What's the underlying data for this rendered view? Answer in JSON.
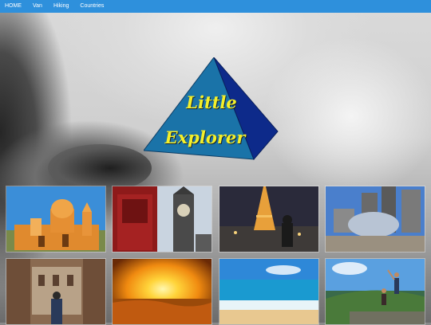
{
  "nav": {
    "items": [
      {
        "label": "HOME"
      },
      {
        "label": "Van"
      },
      {
        "label": "Hiking"
      },
      {
        "label": "Countries"
      }
    ]
  },
  "logo": {
    "line1": "Little",
    "line2": "Explorer",
    "colors": {
      "text": "#f3ef2a",
      "face_light": "#1a73a8",
      "face_dark": "#0d2a8a"
    }
  },
  "gallery": {
    "photos": [
      {
        "subject": "church-photo"
      },
      {
        "subject": "big-ben-photo"
      },
      {
        "subject": "eiffel-tower-photo"
      },
      {
        "subject": "chicago-bean-photo"
      },
      {
        "subject": "colosseum-photo"
      },
      {
        "subject": "desert-sunset-photo"
      },
      {
        "subject": "beach-photo"
      },
      {
        "subject": "hikers-summit-photo"
      }
    ]
  },
  "colors": {
    "nav_bg": "#2e90dc",
    "nav_text": "#ffffff"
  }
}
